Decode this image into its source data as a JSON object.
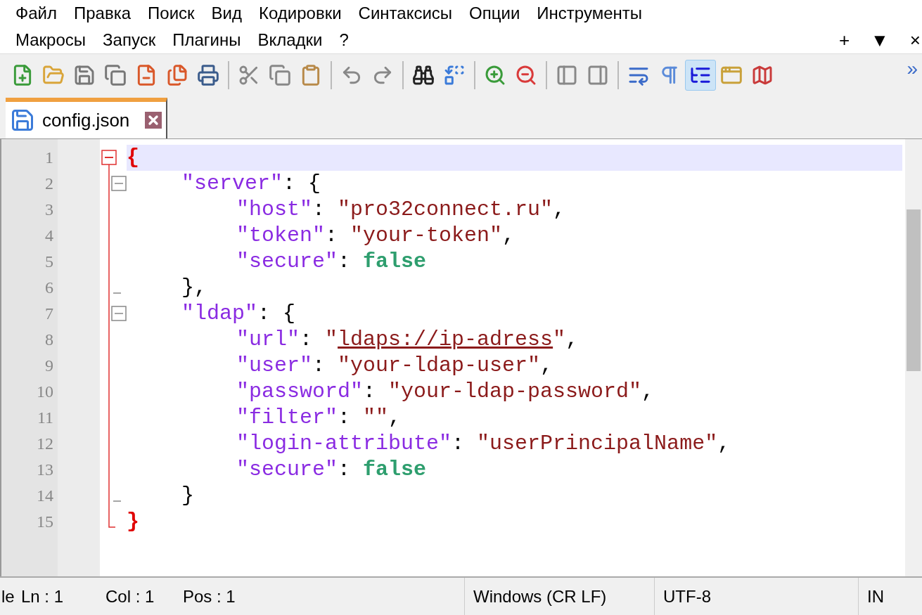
{
  "menu_rows": [
    [
      "Файл",
      "Правка",
      "Поиск",
      "Вид",
      "Кодировки",
      "Синтаксисы",
      "Опции",
      "Инструменты"
    ],
    [
      "Макросы",
      "Запуск",
      "Плагины",
      "Вкладки",
      "?"
    ]
  ],
  "window_controls": [
    "+",
    "▼",
    "×"
  ],
  "toolbar": [
    {
      "kind": "new",
      "pressed": false
    },
    {
      "kind": "open",
      "pressed": false
    },
    {
      "kind": "save",
      "pressed": false
    },
    {
      "kind": "save-all",
      "pressed": false
    },
    {
      "kind": "close",
      "pressed": false
    },
    {
      "kind": "close-all",
      "pressed": false
    },
    {
      "kind": "print",
      "pressed": false
    },
    {
      "kind": "separator"
    },
    {
      "kind": "cut",
      "pressed": false
    },
    {
      "kind": "copy",
      "pressed": false
    },
    {
      "kind": "paste",
      "pressed": false
    },
    {
      "kind": "separator"
    },
    {
      "kind": "undo",
      "pressed": false
    },
    {
      "kind": "redo",
      "pressed": false
    },
    {
      "kind": "separator"
    },
    {
      "kind": "find",
      "pressed": false
    },
    {
      "kind": "replace",
      "pressed": false
    },
    {
      "kind": "separator"
    },
    {
      "kind": "zoom-in",
      "pressed": false
    },
    {
      "kind": "zoom-out",
      "pressed": false
    },
    {
      "kind": "separator"
    },
    {
      "kind": "sync-v",
      "pressed": false
    },
    {
      "kind": "sync-h",
      "pressed": false
    },
    {
      "kind": "separator"
    },
    {
      "kind": "wrap",
      "pressed": false
    },
    {
      "kind": "pilcrow",
      "pressed": false
    },
    {
      "kind": "indent-guide",
      "pressed": true
    },
    {
      "kind": "panel",
      "pressed": false
    },
    {
      "kind": "map",
      "pressed": false
    }
  ],
  "overflow": "»",
  "tabs": [
    {
      "label": "config.json",
      "selected": true
    }
  ],
  "editor": {
    "lines": [
      {
        "number": "1",
        "current": true,
        "kind": "open",
        "tokens": [
          {
            "kind": "brace",
            "text": "{"
          }
        ],
        "children": [
          {
            "number": "2",
            "current": false,
            "kind": "open",
            "tokens": [
              {
                "kind": "key",
                "text": "\"server\""
              },
              {
                "kind": "punct",
                "text": ": {"
              }
            ],
            "children": [
              {
                "number": "3",
                "current": false,
                "kind": "plain",
                "tokens": [
                  {
                    "kind": "key",
                    "text": "\"host\""
                  },
                  {
                    "kind": "punct",
                    "text": ": "
                  },
                  {
                    "kind": "string",
                    "text": "\"pro32connect.ru\""
                  },
                  {
                    "kind": "punct",
                    "text": ","
                  }
                ]
              },
              {
                "number": "4",
                "current": false,
                "kind": "plain",
                "tokens": [
                  {
                    "kind": "key",
                    "text": "\"token\""
                  },
                  {
                    "kind": "punct",
                    "text": ": "
                  },
                  {
                    "kind": "string",
                    "text": "\"your-token\""
                  },
                  {
                    "kind": "punct",
                    "text": ","
                  }
                ]
              },
              {
                "number": "5",
                "current": false,
                "kind": "plain",
                "tokens": [
                  {
                    "kind": "key",
                    "text": "\"secure\""
                  },
                  {
                    "kind": "punct",
                    "text": ": "
                  },
                  {
                    "kind": "bool",
                    "text": "false"
                  }
                ]
              }
            ]
          },
          {
            "number": "6",
            "current": false,
            "kind": "close",
            "tokens": [
              {
                "kind": "punct",
                "text": "},"
              }
            ]
          },
          {
            "number": "7",
            "current": false,
            "kind": "open",
            "tokens": [
              {
                "kind": "key",
                "text": "\"ldap\""
              },
              {
                "kind": "punct",
                "text": ": {"
              }
            ],
            "children": [
              {
                "number": "8",
                "current": false,
                "kind": "plain",
                "tokens": [
                  {
                    "kind": "key",
                    "text": "\"url\""
                  },
                  {
                    "kind": "punct",
                    "text": ": "
                  },
                  {
                    "kind": "string",
                    "text": "\""
                  },
                  {
                    "kind": "link",
                    "text": "ldaps://ip-adress"
                  },
                  {
                    "kind": "string",
                    "text": "\""
                  },
                  {
                    "kind": "punct",
                    "text": ","
                  }
                ]
              },
              {
                "number": "9",
                "current": false,
                "kind": "plain",
                "tokens": [
                  {
                    "kind": "key",
                    "text": "\"user\""
                  },
                  {
                    "kind": "punct",
                    "text": ": "
                  },
                  {
                    "kind": "string",
                    "text": "\"your-ldap-user\""
                  },
                  {
                    "kind": "punct",
                    "text": ","
                  }
                ]
              },
              {
                "number": "10",
                "current": false,
                "kind": "plain",
                "tokens": [
                  {
                    "kind": "key",
                    "text": "\"password\""
                  },
                  {
                    "kind": "punct",
                    "text": ": "
                  },
                  {
                    "kind": "string",
                    "text": "\"your-ldap-password\""
                  },
                  {
                    "kind": "punct",
                    "text": ","
                  }
                ]
              },
              {
                "number": "11",
                "current": false,
                "kind": "plain",
                "tokens": [
                  {
                    "kind": "key",
                    "text": "\"filter\""
                  },
                  {
                    "kind": "punct",
                    "text": ": "
                  },
                  {
                    "kind": "string",
                    "text": "\"\""
                  },
                  {
                    "kind": "punct",
                    "text": ","
                  }
                ]
              },
              {
                "number": "12",
                "current": false,
                "kind": "plain",
                "tokens": [
                  {
                    "kind": "key",
                    "text": "\"login-attribute\""
                  },
                  {
                    "kind": "punct",
                    "text": ": "
                  },
                  {
                    "kind": "string",
                    "text": "\"userPrincipalName\""
                  },
                  {
                    "kind": "punct",
                    "text": ","
                  }
                ]
              },
              {
                "number": "13",
                "current": false,
                "kind": "plain",
                "tokens": [
                  {
                    "kind": "key",
                    "text": "\"secure\""
                  },
                  {
                    "kind": "punct",
                    "text": ": "
                  },
                  {
                    "kind": "bool",
                    "text": "false"
                  }
                ]
              }
            ]
          },
          {
            "number": "14",
            "current": false,
            "kind": "close",
            "tokens": [
              {
                "kind": "punct",
                "text": "}"
              }
            ]
          }
        ]
      },
      {
        "number": "15",
        "current": false,
        "kind": "close",
        "tokens": [
          {
            "kind": "brace",
            "text": "}"
          }
        ]
      }
    ]
  },
  "status_bar": [
    "le",
    "Ln : 1",
    "Col : 1",
    "Pos : 1",
    "Windows (CR LF)",
    "UTF-8",
    "IN"
  ]
}
